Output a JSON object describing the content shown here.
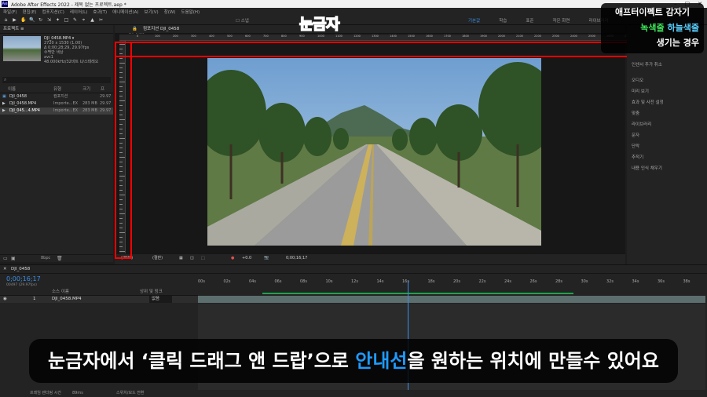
{
  "window": {
    "title": "Adobe After Effects 2022 - 제목 없는 프로젝트.aep *",
    "logo": "Ae"
  },
  "menu": [
    "파일(F)",
    "편집(E)",
    "컴포지션(C)",
    "레이어(L)",
    "효과(T)",
    "애니메이션(A)",
    "보기(V)",
    "창(W)",
    "도움말(H)"
  ],
  "toolbar": {
    "tools": [
      "⌂",
      "▶",
      "✋",
      "🔍",
      "↻",
      "⇲",
      "✦",
      "□",
      "✎",
      "⌖",
      "▲",
      "✂"
    ],
    "snap_label": "스냅",
    "workspaces": [
      {
        "label": "기본값",
        "active": true
      },
      {
        "label": "학습",
        "active": false
      },
      {
        "label": "표준",
        "active": false
      },
      {
        "label": "작은 화면",
        "active": false
      },
      {
        "label": "라이브러리",
        "active": false
      }
    ]
  },
  "project": {
    "header": "프로젝트",
    "footage": {
      "name": "DJI_0458.MP4 ▾",
      "dims": "2720 x 1530 (1.00)",
      "duration": "Δ 0;00;28;29, 29.97fps",
      "color": "수백만 색상",
      "codec": "avc1",
      "audio": "48.000kHz/32비트 U/스테레오"
    },
    "columns": [
      "이름",
      "유형",
      "크기",
      "프"
    ],
    "rows": [
      {
        "name": "DJI_0458",
        "type": "컴포지션",
        "size": "",
        "fps": "29.97",
        "selected": false
      },
      {
        "name": "DJI_0458.MP4",
        "type": "Importe...EX",
        "size": "283 MB",
        "fps": "29.97",
        "selected": false
      },
      {
        "name": "DJI_045...4.MP4",
        "type": "Importe...EX",
        "size": "283 MB",
        "fps": "29.97",
        "selected": true
      }
    ],
    "bpc": "8bpc"
  },
  "comp": {
    "tab": "컴포지션 DJI_0458",
    "subtab": "DJI_0458",
    "ruler_labels": [
      "0",
      "100",
      "200",
      "300",
      "400",
      "500",
      "600",
      "700",
      "800",
      "900",
      "1000",
      "1100",
      "1200",
      "1300",
      "1400",
      "1500",
      "1600",
      "1700",
      "1800",
      "1900",
      "2000",
      "2100",
      "2200",
      "2300",
      "2400",
      "2500",
      "2600",
      "2700"
    ],
    "zoom": "(25%)",
    "resolution": "(절반)",
    "exposure": "+0.0",
    "timecode": "0;00;16;17"
  },
  "right_panel": {
    "top": "인센서 추가 취소",
    "items": [
      "오디오",
      "미리 보기",
      "효과 및 사전 설정",
      "맞춤",
      "라이브러리",
      "문자",
      "단락",
      "추적기",
      "내용 인식 채우기"
    ]
  },
  "timeline": {
    "tab": "DJI_0458",
    "time": "0;00;16;17",
    "frames": "00497 (29.97fps)",
    "columns": {
      "source": "소스 이름",
      "parent": "상위 및 링크"
    },
    "layer": {
      "index": "1",
      "name": "DJI_0458.MP4",
      "parent": "없음"
    },
    "ruler": [
      "00s",
      "02s",
      "04s",
      "06s",
      "08s",
      "10s",
      "12s",
      "14s",
      "16s",
      "18s",
      "20s",
      "22s",
      "24s",
      "26s",
      "28s",
      "30s",
      "32s",
      "34s",
      "36s",
      "38s"
    ]
  },
  "statusbar": {
    "left": "프레임 렌더링 시간",
    "value": "89ms",
    "mode": "스위치/모드 전환"
  },
  "overlays": {
    "title": "눈금자",
    "card": {
      "line1": "애프터이펙트 감자기",
      "line2a": "녹색줄",
      "line2b": "하늘색줄",
      "line3": "생기는 경우"
    },
    "subtitle_pre": "눈금자에서 ‘클릭 드래그 앤 드랍’으로 ",
    "subtitle_hl": "안내선",
    "subtitle_post": "을 원하는 위치에 만들수 있어요"
  },
  "colors": {
    "accent": "#3a8ee6",
    "highlight": "#ff0000",
    "subtitle_hl": "#1e9bff",
    "green_line": "#1fa34a",
    "sky_line": "#5ad1ff"
  }
}
